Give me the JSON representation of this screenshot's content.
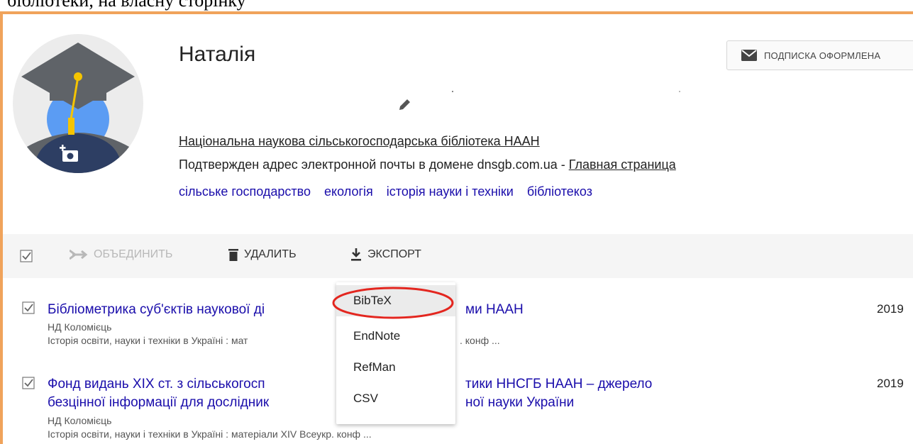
{
  "page_header_text": "бібліотеки, на власну сторінку",
  "profile": {
    "name": "Наталія",
    "affiliation": "Національна наукова сільськогосподарська бібліотека НААН",
    "email_text": "Подтвержден адрес электронной почты в домене dnsgb.com.ua - ",
    "homepage_link": "Главная страница",
    "interests": [
      "сільське господарство",
      "екологія",
      "історія науки і техніки",
      "бібліотекоз"
    ]
  },
  "subscribe": {
    "label": "ПОДПИСКА ОФОРМЛЕНА",
    "icon": "mail-icon"
  },
  "toolbar": {
    "merge_label": "ОБЪЕДИНИТЬ",
    "delete_label": "УДАЛИТЬ",
    "export_label": "ЭКСПОРТ"
  },
  "export_menu": {
    "items": [
      "BibTeX",
      "EndNote",
      "RefMan",
      "CSV"
    ],
    "highlighted": "BibTeX"
  },
  "articles": [
    {
      "title_line1": "Бібліометрика суб'єктів наукової ді",
      "title_line1_tail": "ми НААН",
      "authors": "НД Коломієць",
      "venue": "Історія освіти, науки і техніки в Україні : мат",
      "venue_tail": ". конф ...",
      "year": "2019",
      "checked": true
    },
    {
      "title_line1": "Фонд видань XIX ст. з сільськогосп",
      "title_line1_tail": "тики ННСГБ НААН – джерело",
      "title_line2": "безцінної інформації для дослідник",
      "title_line2_tail": "ної науки України",
      "authors": "НД Коломієць",
      "venue": "Історія освіти, науки і техніки в Україні : матеріали XIV Всеукр. конф ...",
      "year": "2019",
      "checked": true
    }
  ],
  "colors": {
    "frame": "#f0a35b",
    "link": "#1a0dab",
    "annotation": "#e3261f"
  }
}
